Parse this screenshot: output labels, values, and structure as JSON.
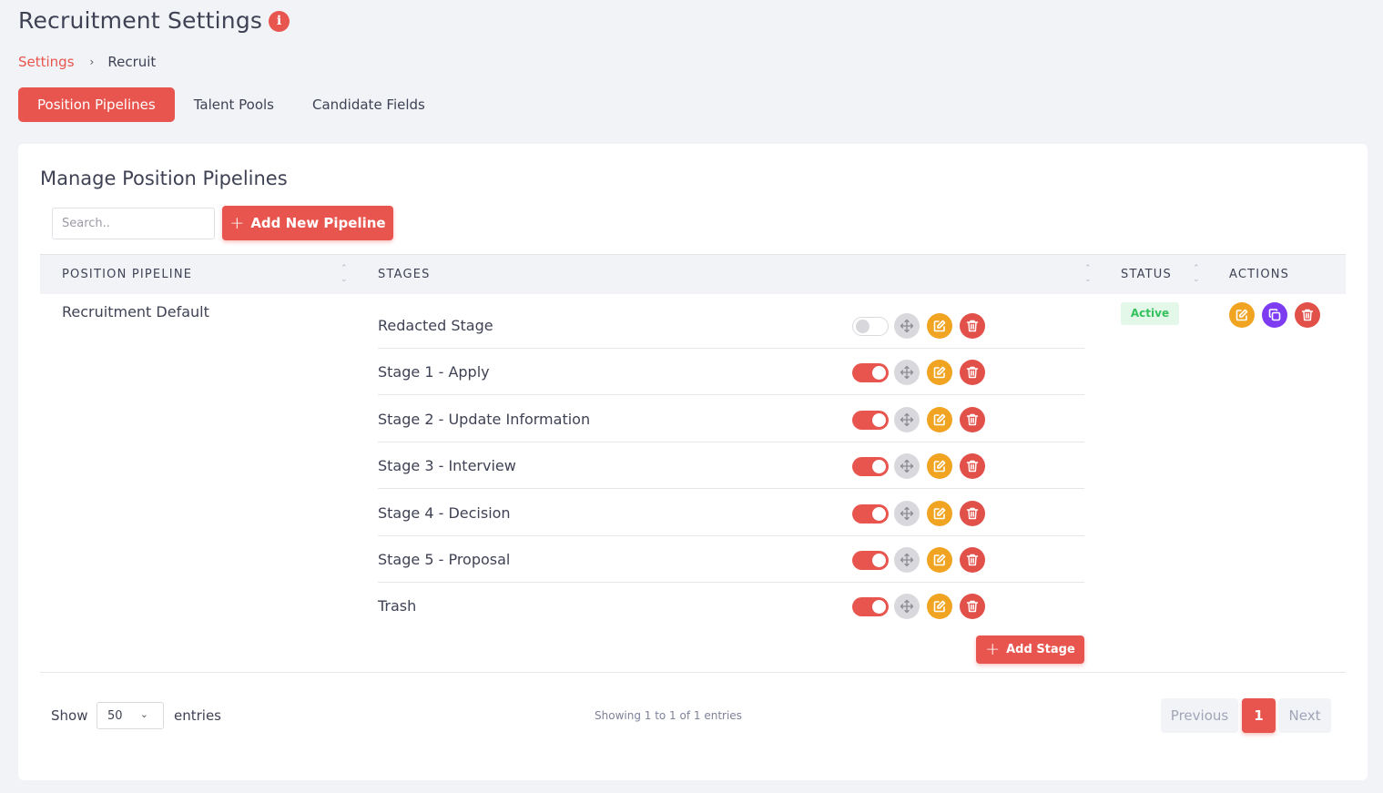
{
  "header": {
    "title": "Recruitment Settings",
    "info_icon": "i"
  },
  "breadcrumb": {
    "link": "Settings",
    "separator": "›",
    "current": "Recruit"
  },
  "tabs": [
    {
      "label": "Position Pipelines",
      "active": true
    },
    {
      "label": "Talent Pools",
      "active": false
    },
    {
      "label": "Candidate Fields",
      "active": false
    }
  ],
  "card": {
    "title": "Manage Position Pipelines",
    "search_placeholder": "Search..",
    "add_pipeline_label": "Add New Pipeline",
    "plus": "+"
  },
  "table": {
    "headers": {
      "pipeline": "POSITION PIPELINE",
      "stages": "STAGES",
      "status": "STATUS",
      "actions": "ACTIONS"
    },
    "row": {
      "pipeline_name": "Recruitment Default",
      "status": "Active",
      "stages": [
        {
          "name": "Redacted Stage",
          "enabled": false
        },
        {
          "name": "Stage 1 - Apply",
          "enabled": true
        },
        {
          "name": "Stage 2 - Update Information",
          "enabled": true
        },
        {
          "name": "Stage 3 - Interview",
          "enabled": true
        },
        {
          "name": "Stage 4 - Decision",
          "enabled": true
        },
        {
          "name": "Stage 5 - Proposal",
          "enabled": true
        },
        {
          "name": "Trash",
          "enabled": true
        }
      ],
      "add_stage_label": "Add Stage"
    }
  },
  "footer": {
    "show_label": "Show",
    "entries_value": "50",
    "entries_label": "entries",
    "showing_text": "Showing 1 to 1 of 1 entries",
    "prev_label": "Previous",
    "page": "1",
    "next_label": "Next"
  },
  "colors": {
    "accent": "#e8554e",
    "edit": "#f0a422",
    "copy": "#7d3cf2",
    "delete": "#e2504a",
    "active_badge": "#35c05e"
  },
  "icons": {
    "move": "move-icon",
    "edit": "edit-icon",
    "delete": "trash-icon",
    "copy": "copy-icon",
    "chevron": "chevron-down-icon"
  }
}
